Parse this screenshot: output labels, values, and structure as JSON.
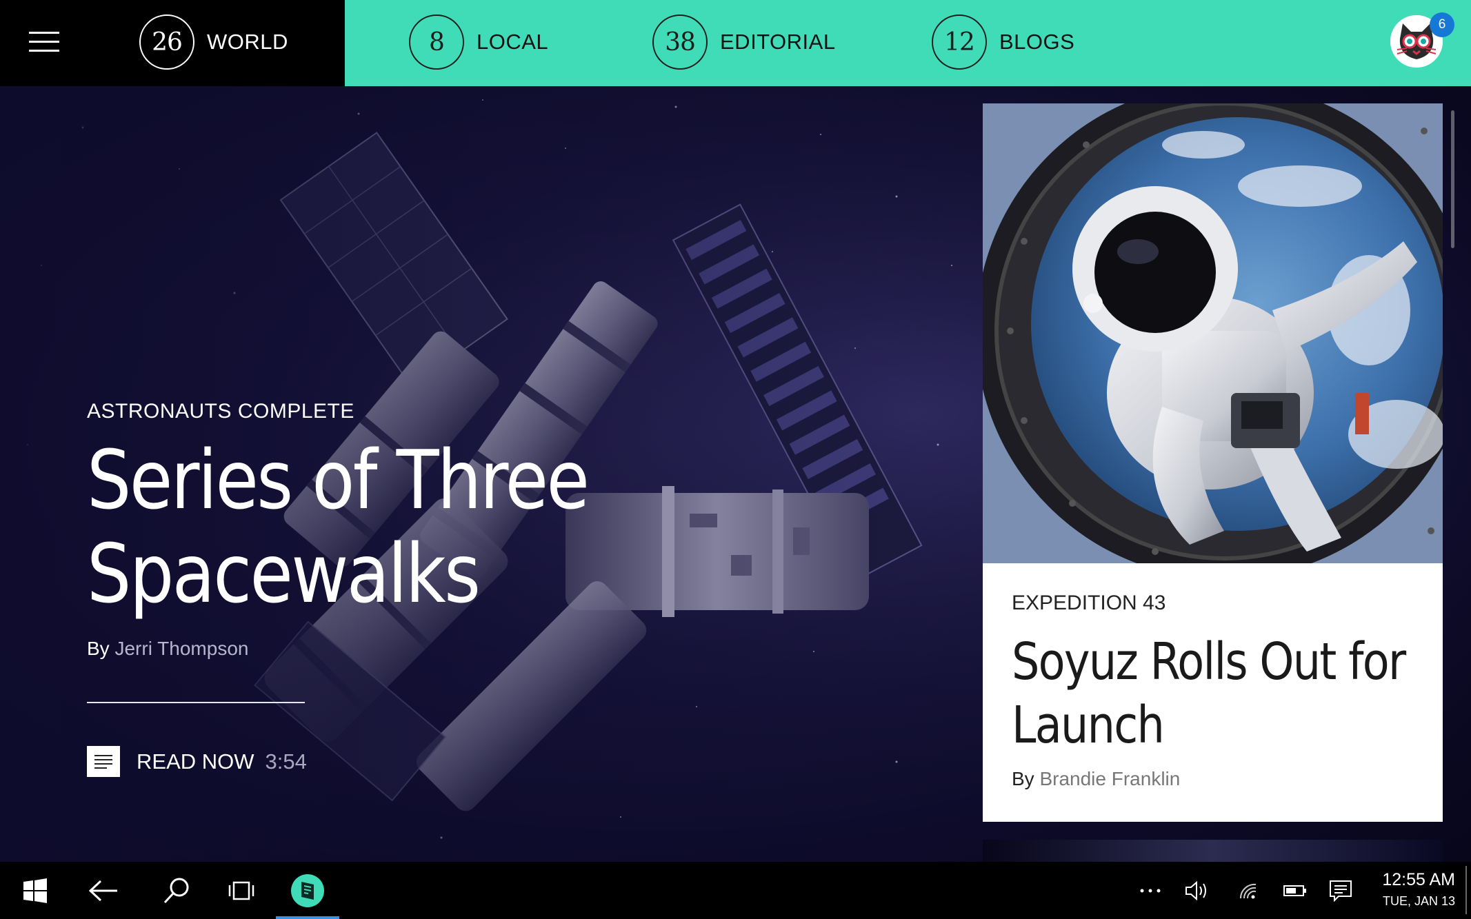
{
  "nav": {
    "tabs": [
      {
        "count": "26",
        "label": "WORLD"
      },
      {
        "count": "8",
        "label": "LOCAL"
      },
      {
        "count": "38",
        "label": "EDITORIAL"
      },
      {
        "count": "12",
        "label": "BLOGS"
      }
    ],
    "notification_count": "6",
    "colors": {
      "accent": "#3fdcb7",
      "active_bg": "#000000",
      "badge": "#1478d4"
    }
  },
  "hero": {
    "kicker": "ASTRONAUTS COMPLETE",
    "headline_line1": "Series of Three",
    "headline_line2": "Spacewalks",
    "byline_prefix": "By",
    "author": "Jerri Thompson",
    "read_label": "READ NOW",
    "read_time": "3:54"
  },
  "side_card": {
    "kicker": "EXPEDITION 43",
    "title_line1": "Soyuz Rolls Out for",
    "title_line2": "Launch",
    "byline_prefix": "By",
    "author": "Brandie Franklin"
  },
  "taskbar": {
    "icons": [
      "windows-start-icon",
      "back-arrow-icon",
      "search-icon",
      "task-view-icon",
      "news-app-icon"
    ],
    "tray_icons": [
      "more-icon",
      "volume-icon",
      "wifi-icon",
      "battery-icon",
      "action-center-icon"
    ],
    "time": "12:55 AM",
    "date": "TUE, JAN 13"
  }
}
